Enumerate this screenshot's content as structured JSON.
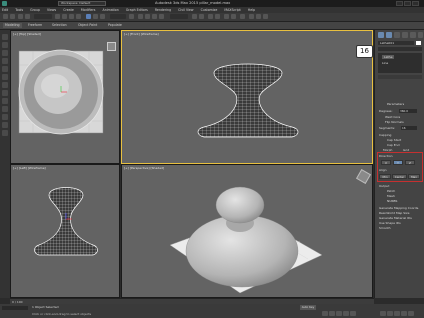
{
  "app": {
    "title": "Autodesk 3ds Max 2015   pillar_model.max",
    "workspace": "Workspace: Default"
  },
  "menu": {
    "items": [
      "Edit",
      "Tools",
      "Group",
      "Views",
      "Create",
      "Modifiers",
      "Animation",
      "Graph Editors",
      "Rendering",
      "Civil View",
      "Customize",
      "MAXScript",
      "Help"
    ]
  },
  "ribbon": {
    "tabs": [
      "Modeling",
      "Freeform",
      "Selection",
      "Object Paint",
      "Populate"
    ]
  },
  "viewports": {
    "top": {
      "label": "[+] [Top] [Shaded]"
    },
    "front": {
      "label": "[+] [Front] [Wireframe]"
    },
    "left": {
      "label": "[+] [Left] [Wireframe]"
    },
    "perspective": {
      "label": "[+] [Perspective] [Shaded]"
    }
  },
  "command_panel": {
    "object_name": "Lathe001",
    "modifier_stack": [
      "Lathe",
      "Line"
    ],
    "parameters_title": "Parameters",
    "degrees_label": "Degrees:",
    "degrees_value": "360.0",
    "weld_core": "Weld Core",
    "flip_normals": "Flip Normals",
    "segments_label": "Segments:",
    "segments_value": "16",
    "capping_title": "Capping",
    "cap_start": "Cap Start",
    "cap_end": "Cap End",
    "morph": "Morph",
    "grid": "Grid",
    "direction_title": "Direction",
    "dir_x": "X",
    "dir_y": "Y",
    "dir_z": "Z",
    "align_title": "Align",
    "align_min": "Min",
    "align_center": "Center",
    "align_max": "Max",
    "output_title": "Output",
    "output_patch": "Patch",
    "output_mesh": "Mesh",
    "output_nurbs": "NURBS",
    "gen_mapping": "Generate Mapping Coords.",
    "real_world": "Real-World Map Size",
    "gen_mat_ids": "Generate Material IDs",
    "use_shape_ids": "Use Shape IDs",
    "smooth": "Smooth"
  },
  "step_badge": "16",
  "timeline": {
    "frame": "0 / 100"
  },
  "status": {
    "selection": "1 Object Selected",
    "prompt": "Click or click-and-drag to select objects",
    "auto_key": "Auto Key"
  },
  "colors": {
    "viewport_bg": "#636363",
    "active_border": "#e8c040",
    "highlight_red": "#c53030",
    "wire": "#ffffff",
    "object_shaded": "#c8c8c8"
  }
}
